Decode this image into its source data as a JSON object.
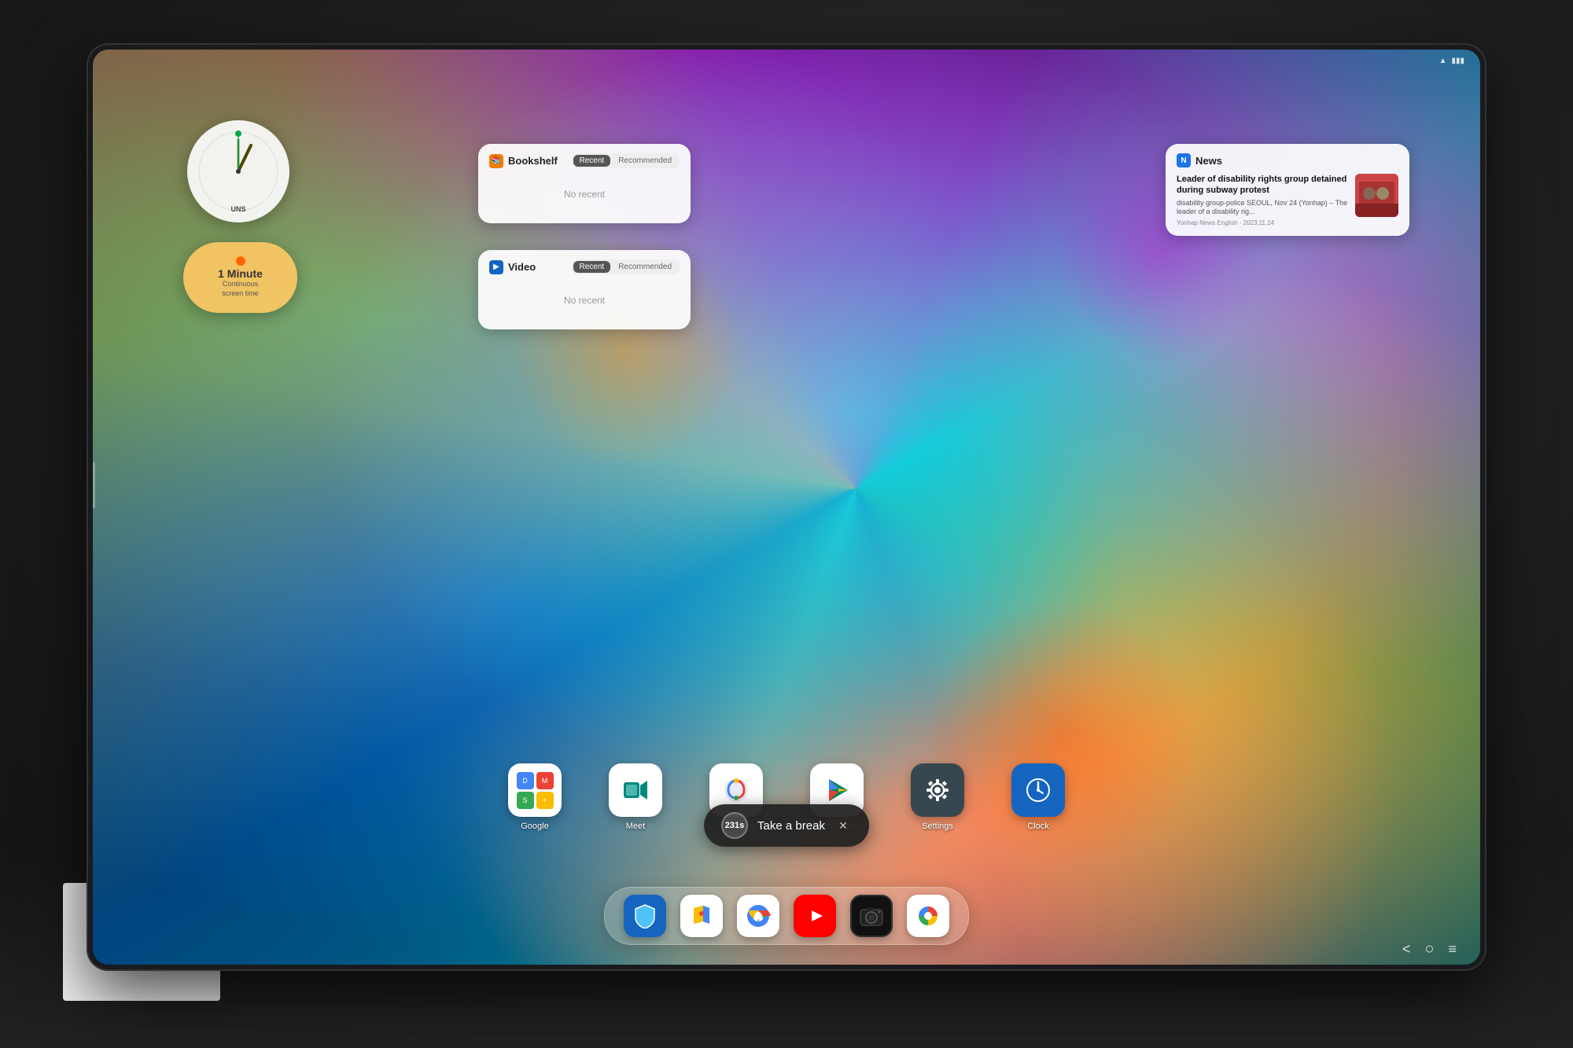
{
  "background": {
    "color": "#1a1a1a"
  },
  "tablet": {
    "borderRadius": "28px"
  },
  "widgets": {
    "clock": {
      "time": "1",
      "label": "UNS"
    },
    "screentime": {
      "duration": "1 Minute",
      "subtitle": "Continuous\nscreen time"
    },
    "bookshelf": {
      "title": "Bookshelf",
      "tab_recent": "Recent",
      "tab_recommended": "Recommended",
      "active_tab": "recent",
      "no_recent_text": "No recent"
    },
    "video": {
      "title": "Video",
      "tab_recent": "Recent",
      "tab_recommended": "Recommended",
      "active_tab": "recent",
      "no_recent_text": "No recent"
    },
    "news": {
      "title": "News",
      "headline": "Leader of disability rights group detained during subway protest",
      "body": "disability group-police SEOUL, Nov 24 (Yonhap) – The leader of a disability rig...",
      "meta": "Yonhap News English · 2023.11.24"
    }
  },
  "apps": [
    {
      "name": "Google",
      "label": "Google",
      "bg": "#ffffff",
      "icon_type": "google-group"
    },
    {
      "name": "Meet",
      "label": "Meet",
      "bg": "#ffffff",
      "icon_type": "meet"
    },
    {
      "name": "Assistant",
      "label": "Assistant",
      "bg": "#ffffff",
      "icon_type": "assistant"
    },
    {
      "name": "Play Store",
      "label": "Play Store",
      "bg": "#ffffff",
      "icon_type": "playstore"
    },
    {
      "name": "Settings",
      "label": "Settings",
      "bg": "#2979ff",
      "icon_type": "settings"
    },
    {
      "name": "Clock",
      "label": "Clock",
      "bg": "#1565c0",
      "icon_type": "clock"
    }
  ],
  "dock": [
    {
      "name": "Security",
      "icon": "🛡",
      "bg": "#1565c0",
      "label": "Knox"
    },
    {
      "name": "Google Maps",
      "icon": "🗺",
      "bg": "#ffffff",
      "label": "Maps"
    },
    {
      "name": "Chrome",
      "icon": "⦿",
      "bg": "#ffffff",
      "label": "Chrome"
    },
    {
      "name": "YouTube",
      "icon": "▶",
      "bg": "#ff0000",
      "label": "YouTube"
    },
    {
      "name": "Camera",
      "icon": "⊙",
      "bg": "#111111",
      "label": "Camera"
    },
    {
      "name": "Photos",
      "icon": "✿",
      "bg": "#ffffff",
      "label": "Photos"
    }
  ],
  "break_toast": {
    "timer": "231s",
    "text": "Take a break",
    "close": "✕"
  },
  "nav_bar": {
    "back": "<",
    "home": "○",
    "recents": "≡"
  }
}
